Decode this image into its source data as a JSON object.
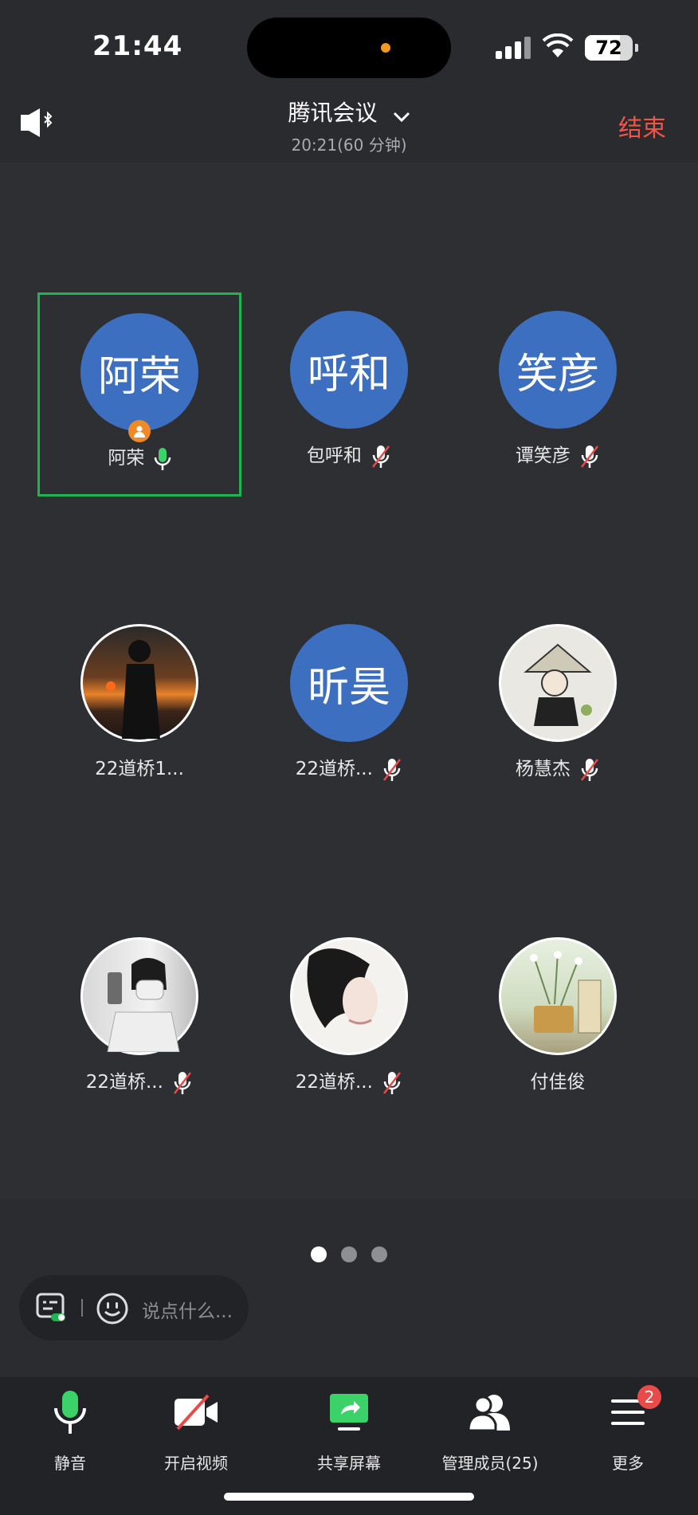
{
  "status": {
    "time": "21:44",
    "battery": "72"
  },
  "header": {
    "title": "腾讯会议",
    "subtitle": "20:21(60 分钟)",
    "end_label": "结束"
  },
  "participants": [
    {
      "name": "阿荣",
      "avatar_text": "阿荣",
      "mic": "on",
      "host": true
    },
    {
      "name": "包呼和",
      "avatar_text": "呼和",
      "mic": "muted"
    },
    {
      "name": "谭笑彦",
      "avatar_text": "笑彦",
      "mic": "muted"
    },
    {
      "name": "22道桥1...",
      "avatar_text": "",
      "mic": "none"
    },
    {
      "name": "22道桥...",
      "avatar_text": "昕昊",
      "mic": "muted"
    },
    {
      "name": "杨慧杰",
      "avatar_text": "",
      "mic": "muted"
    },
    {
      "name": "22道桥...",
      "avatar_text": "",
      "mic": "muted"
    },
    {
      "name": "22道桥...",
      "avatar_text": "",
      "mic": "muted"
    },
    {
      "name": "付佳俊",
      "avatar_text": "",
      "mic": "none"
    }
  ],
  "pagination": {
    "pages": 3,
    "current": 1
  },
  "chat": {
    "placeholder": "说点什么..."
  },
  "toolbar": {
    "mute": "静音",
    "video": "开启视频",
    "share": "共享屏幕",
    "members": "管理成员(25)",
    "more": "更多",
    "more_badge": "2"
  },
  "colors": {
    "accent": "#20b450",
    "danger": "#f1554a",
    "avatar": "#3d6fc0",
    "host_badge": "#f08a24"
  }
}
